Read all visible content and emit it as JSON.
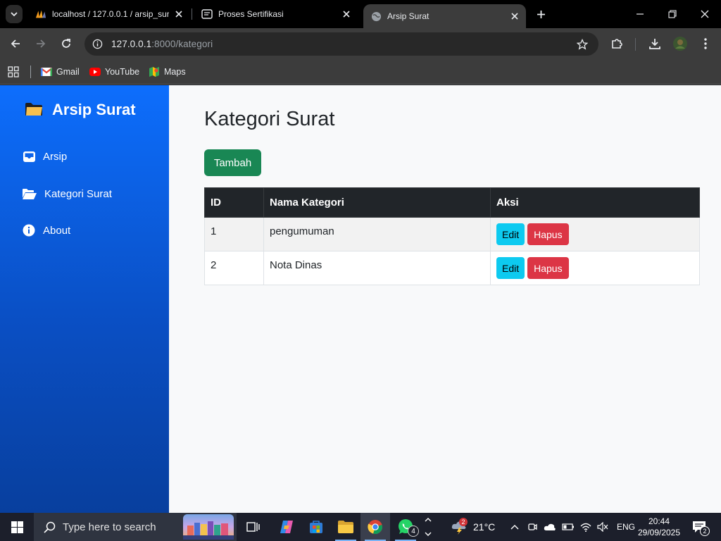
{
  "browser": {
    "tabs": [
      {
        "title": "localhost / 127.0.0.1 / arsip_sura",
        "active": false
      },
      {
        "title": "Proses Sertifikasi",
        "active": false
      },
      {
        "title": "Arsip Surat",
        "active": true
      }
    ],
    "url_host": "127.0.0.1",
    "url_path": ":8000/kategori",
    "bookmarks": [
      {
        "label": "Gmail",
        "icon": "gmail-icon"
      },
      {
        "label": "YouTube",
        "icon": "youtube-icon"
      },
      {
        "label": "Maps",
        "icon": "maps-icon"
      }
    ]
  },
  "sidebar": {
    "brand": "Arsip Surat",
    "items": [
      {
        "label": "Arsip",
        "icon": "inbox-icon"
      },
      {
        "label": "Kategori Surat",
        "icon": "folder-open-icon"
      },
      {
        "label": "About",
        "icon": "info-icon"
      }
    ]
  },
  "main": {
    "title": "Kategori Surat",
    "add_label": "Tambah",
    "table": {
      "headers": [
        "ID",
        "Nama Kategori",
        "Aksi"
      ],
      "rows": [
        {
          "id": "1",
          "name": "pengumuman",
          "edit": "Edit",
          "delete": "Hapus"
        },
        {
          "id": "2",
          "name": "Nota Dinas",
          "edit": "Edit",
          "delete": "Hapus"
        }
      ]
    }
  },
  "taskbar": {
    "search_placeholder": "Type here to search",
    "weather_temp": "21°C",
    "weather_badge": "2",
    "language": "ENG",
    "time": "20:44",
    "date": "29/09/2025",
    "notification_count": "2",
    "whatsapp_badge": "4"
  },
  "colors": {
    "sidebar": "#0d6efd",
    "add_button": "#198754",
    "edit_button": "#0dcaf0",
    "delete_button": "#dc3545",
    "table_header": "#212529"
  }
}
